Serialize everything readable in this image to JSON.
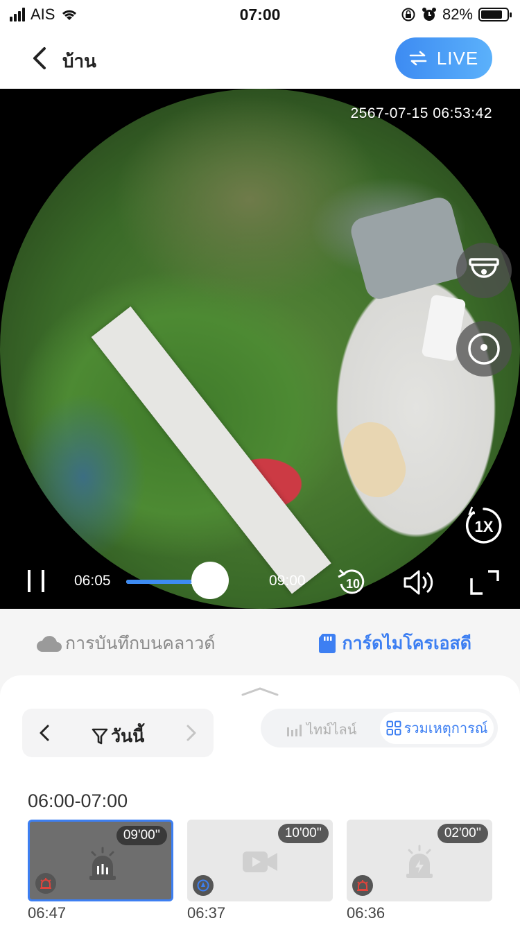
{
  "status_bar": {
    "carrier": "AIS",
    "time": "07:00",
    "battery_percent": "82%",
    "battery_level": 0.82
  },
  "header": {
    "title": "บ้าน",
    "live_label": "LIVE"
  },
  "player": {
    "timestamp": "2567-07-15 06:53:42",
    "time_start": "06:05",
    "time_end": "09:00",
    "progress": 0.45,
    "speed_label": "1X",
    "rewind_label": "10"
  },
  "source_tabs": {
    "cloud": "การบันทึกบนคลาวด์",
    "sd": "การ์ดไมโครเอสดี"
  },
  "filter": {
    "date_label": "วันนี้",
    "view_timeline": "ไทม์ไลน์",
    "view_events": "รวมเหตุการณ์"
  },
  "events": {
    "range_label": "06:00-07:00",
    "items": [
      {
        "duration": "09'00''",
        "time": "06:47",
        "type": "alarm",
        "active": true
      },
      {
        "duration": "10'00''",
        "time": "06:37",
        "type": "video",
        "active": false
      },
      {
        "duration": "02'00''",
        "time": "06:36",
        "type": "alarm",
        "active": false
      }
    ]
  },
  "colors": {
    "accent": "#3d7ff2",
    "live_gradient_start": "#3d8bf2",
    "live_gradient_end": "#5bb1fb"
  }
}
